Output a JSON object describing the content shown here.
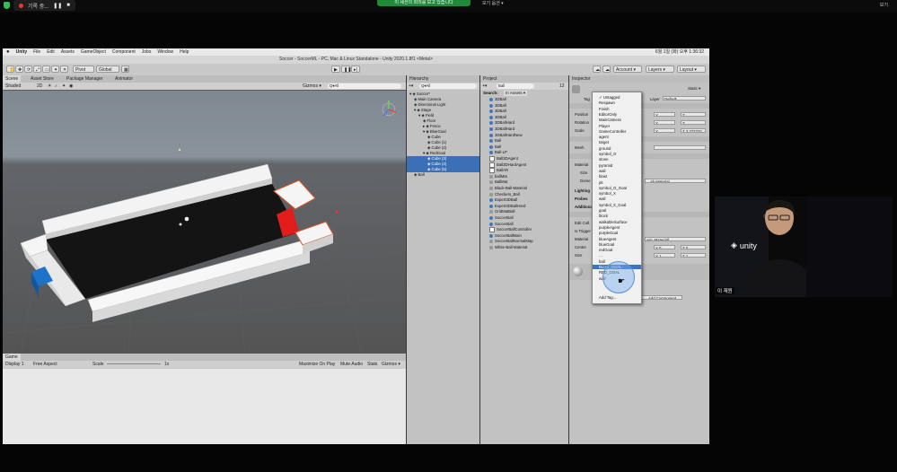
{
  "zoom_bar": {
    "rec_label": "기록 중...",
    "pause": "❚❚",
    "stop": "■",
    "banner": "이 세션의 회의를 보고 있습니다",
    "view_options": "보기 옵션 ▾",
    "view": "보기"
  },
  "mac_menu": {
    "apple": "",
    "items": [
      "Unity",
      "File",
      "Edit",
      "Assets",
      "GameObject",
      "Component",
      "Jobs",
      "Window",
      "Help"
    ],
    "clock": "6월 1일 (화) 오후 1:36:32"
  },
  "window_title": "Soccer - SoccerML - PC, Mac & Linux Standalone - Unity 2020.1.8f1 <Metal>",
  "toolbar": {
    "pivot": "Pivot",
    "global": "Global",
    "account": "Account ▾",
    "layers": "Layers ▾",
    "layout": "Layout ▾"
  },
  "scene": {
    "tabs": [
      "Scene",
      "Asset Store",
      "Package Manager",
      "Animator"
    ],
    "shading": "Shaded",
    "twod": "2D",
    "gizmos": "Gizmos ▾",
    "search_placeholder": "Q▾All"
  },
  "game": {
    "tab": "Game",
    "display": "Display 1",
    "aspect": "Free Aspect",
    "scale_label": "Scale",
    "scale_value": "1x",
    "options": [
      "Maximize On Play",
      "Mute Audio",
      "Stats",
      "Gizmos ▾"
    ]
  },
  "hierarchy": {
    "title": "Hierarchy",
    "search_placeholder": "Q▾All",
    "rows": [
      {
        "label": "▾ ◈ Soccer*",
        "indent": 0,
        "selected": false
      },
      {
        "label": "◈ Main Camera",
        "indent": 1,
        "selected": false
      },
      {
        "label": "◈ Directional Light",
        "indent": 1,
        "selected": false
      },
      {
        "label": "▾ ◈ Stage",
        "indent": 1,
        "selected": false
      },
      {
        "label": "▾ ◈ Field",
        "indent": 2,
        "selected": false
      },
      {
        "label": "◈ Floor",
        "indent": 3,
        "selected": false
      },
      {
        "label": "▸ ◈ Fence",
        "indent": 3,
        "selected": false
      },
      {
        "label": "▾ ◈ BlueGoal",
        "indent": 3,
        "selected": false
      },
      {
        "label": "◈ Cube",
        "indent": 4,
        "selected": false
      },
      {
        "label": "◈ Cube (1)",
        "indent": 4,
        "selected": false
      },
      {
        "label": "◈ Cube (2)",
        "indent": 4,
        "selected": false
      },
      {
        "label": "▾ ◈ RedGoal",
        "indent": 3,
        "selected": false
      },
      {
        "label": "◈ Cube (3)",
        "indent": 4,
        "selected": true
      },
      {
        "label": "◈ Cube (4)",
        "indent": 4,
        "selected": true
      },
      {
        "label": "◈ Cube (5)",
        "indent": 4,
        "selected": true
      },
      {
        "label": "◈ Ball",
        "indent": 1,
        "selected": false
      }
    ]
  },
  "project": {
    "title": "Project",
    "search_label": "Search:",
    "search_scope": "In Assets ▾",
    "search_value": "Ball",
    "count": "12",
    "items": [
      {
        "name": "3DBall",
        "kind": "prefab"
      },
      {
        "name": "3DBall",
        "kind": "prefab"
      },
      {
        "name": "3DBall",
        "kind": "prefab"
      },
      {
        "name": "3DBall",
        "kind": "prefab"
      },
      {
        "name": "3DBallHard",
        "kind": "prefab"
      },
      {
        "name": "3DBallHard",
        "kind": "prefab"
      },
      {
        "name": "3DBallHardNew",
        "kind": "prefab"
      },
      {
        "name": "Ball",
        "kind": "prefab"
      },
      {
        "name": "Ball",
        "kind": "prefab"
      },
      {
        "name": "Ball-LP",
        "kind": "prefab"
      },
      {
        "name": "Ball3DAgent",
        "kind": "script"
      },
      {
        "name": "Ball3DHardAgent",
        "kind": "script"
      },
      {
        "name": "BallAR",
        "kind": "script"
      },
      {
        "name": "ballMat",
        "kind": "mat"
      },
      {
        "name": "BallMat",
        "kind": "mat"
      },
      {
        "name": "Black-Ball-Material",
        "kind": "mat"
      },
      {
        "name": "Checkers_Ball",
        "kind": "mat"
      },
      {
        "name": "Expert3DBall",
        "kind": "prefab"
      },
      {
        "name": "Expert3DBallHard",
        "kind": "prefab"
      },
      {
        "name": "GridMatBall",
        "kind": "mat"
      },
      {
        "name": "SoccerBall",
        "kind": "prefab"
      },
      {
        "name": "SoccerBall",
        "kind": "prefab"
      },
      {
        "name": "SoccerBallController",
        "kind": "script"
      },
      {
        "name": "SoccerBallMain",
        "kind": "prefab"
      },
      {
        "name": "SoccerBallNormalMap",
        "kind": "mat"
      },
      {
        "name": "White-Ball-Material",
        "kind": "mat"
      }
    ]
  },
  "inspector": {
    "title": "Inspector",
    "static": "Static ▾",
    "tag_label": "Tag",
    "layer_label": "Layer",
    "layer_value": "Default",
    "rows": [
      {
        "label": "Position",
        "x": "X",
        "y": "Y",
        "z": "Z"
      },
      {
        "label": "Rotation",
        "x": "X",
        "y": "Y",
        "z": "Z"
      },
      {
        "label": "Scale",
        "x": "X",
        "y": "Y",
        "z": "Z 3.272232"
      }
    ],
    "sections": [
      "Mesh",
      "Material",
      "Size",
      "Dome",
      "Lighting",
      "Probes",
      "Additional",
      "Edit Coll.",
      "Is Trigger",
      "Material",
      "Center",
      "Size"
    ],
    "material_value": "…ah Material",
    "phys_material": "ysic Material)",
    "center_vals": [
      "X 0",
      "Y 0",
      "Z 0"
    ],
    "size_vals": [
      "X 1",
      "Y 1",
      "Z 1"
    ],
    "component_label": "Add Component"
  },
  "tag_dropdown": {
    "items": [
      "✓ Untagged",
      "Respawn",
      "Finish",
      "EditorOnly",
      "MainCamera",
      "Player",
      "GameController",
      "agent",
      "target",
      "ground",
      "symbol_O",
      "stone",
      "pyramid",
      "wall",
      "blast",
      "pit",
      "symbol_O_Goal",
      "symbol_X",
      "wall",
      "symbol_X_Goal",
      "goal",
      "block",
      "walkableSurface",
      "purpleAgent",
      "purpleGoal",
      "blueAgent",
      "blueGoal",
      "redGoal",
      "…",
      "ball",
      "BLUE_GOAL",
      "RED_GOAL",
      "wall"
    ],
    "highlighted_index": 30,
    "add_tag": "Add Tag..."
  },
  "webcam": {
    "name": "이 재원",
    "logo_text": "unity"
  }
}
